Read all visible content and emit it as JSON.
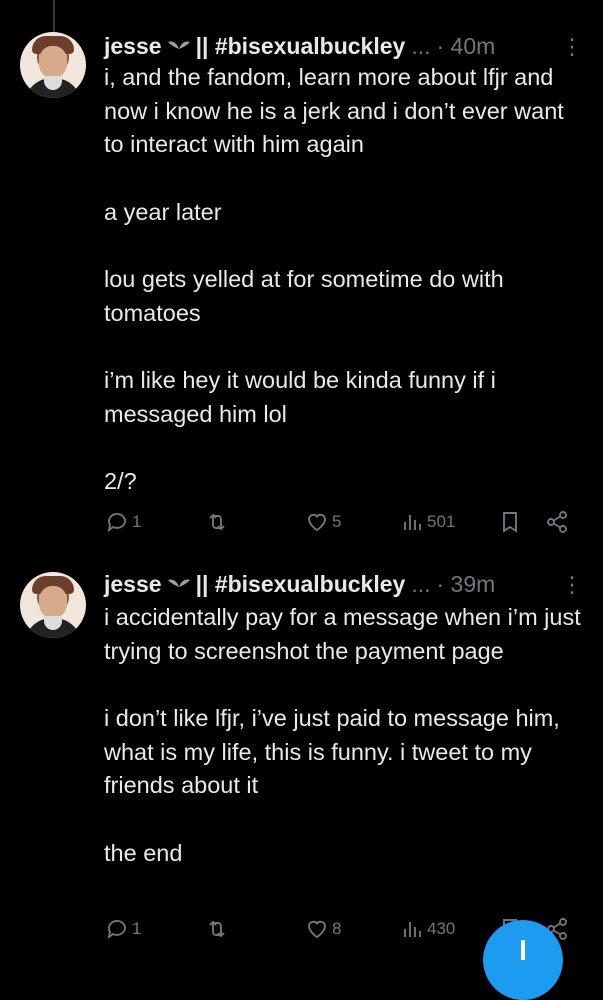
{
  "tweets": [
    {
      "display_name": "jesse",
      "handle": "|| #bisexualbuckley",
      "ellipsis": "...",
      "time": "· 40m",
      "more_icon": "more-dots-icon",
      "paragraphs": [
        "i, and the fandom, learn more about lfjr and now i know he is a jerk and i don’t ever want to interact with him again",
        "a year later",
        "lou gets yelled at for sometime do with tomatoes",
        "i’m like hey it would be kinda funny if i messaged him lol",
        "2/?"
      ],
      "stats": {
        "replies": "1",
        "reposts": "",
        "likes": "5",
        "views": "501"
      }
    },
    {
      "display_name": "jesse",
      "handle": "|| #bisexualbuckley",
      "ellipsis": "...",
      "time": "· 39m",
      "more_icon": "more-dots-icon",
      "paragraphs": [
        "i accidentally pay for a message when i’m just trying to screenshot the payment page",
        "i don’t like lfjr, i’ve just paid to message him, what is my life, this is funny. i tweet to my friends about it",
        "the end"
      ],
      "stats": {
        "replies": "1",
        "reposts": "",
        "likes": "8",
        "views": "430"
      }
    }
  ],
  "colors": {
    "background": "#000000",
    "text": "#e7e9ea",
    "muted": "#71767b",
    "accent": "#1d9bf0"
  }
}
